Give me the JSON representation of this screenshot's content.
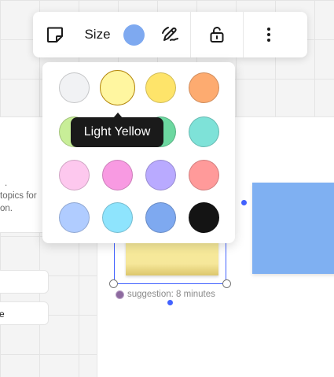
{
  "toolbar": {
    "size_label": "Size",
    "current_color": "#7ea9f0"
  },
  "color_palette": {
    "selected": "Light Yellow",
    "swatches": [
      {
        "color": "#f1f2f4"
      },
      {
        "color": "#fff6a0"
      },
      {
        "color": "#fee46a"
      },
      {
        "color": "#fdab70"
      },
      {
        "color": "#c8ee98"
      },
      {
        "color": "#88ec98"
      },
      {
        "color": "#6cd8a0"
      },
      {
        "color": "#7ee2d8"
      },
      {
        "color": "#fdc8ee"
      },
      {
        "color": "#f89ae2"
      },
      {
        "color": "#b9aaff"
      },
      {
        "color": "#ff9a9a"
      },
      {
        "color": "#b0ccff"
      },
      {
        "color": "#8ee4fd"
      },
      {
        "color": "#7ea9f0"
      },
      {
        "color": "#141414"
      }
    ]
  },
  "tooltip": {
    "text": "Light Yellow"
  },
  "canvas": {
    "side_card_lines": [
      ".",
      "topics for",
      "on."
    ],
    "side_field_2": "e",
    "suggestion_text": "suggestion: 8 minutes"
  }
}
